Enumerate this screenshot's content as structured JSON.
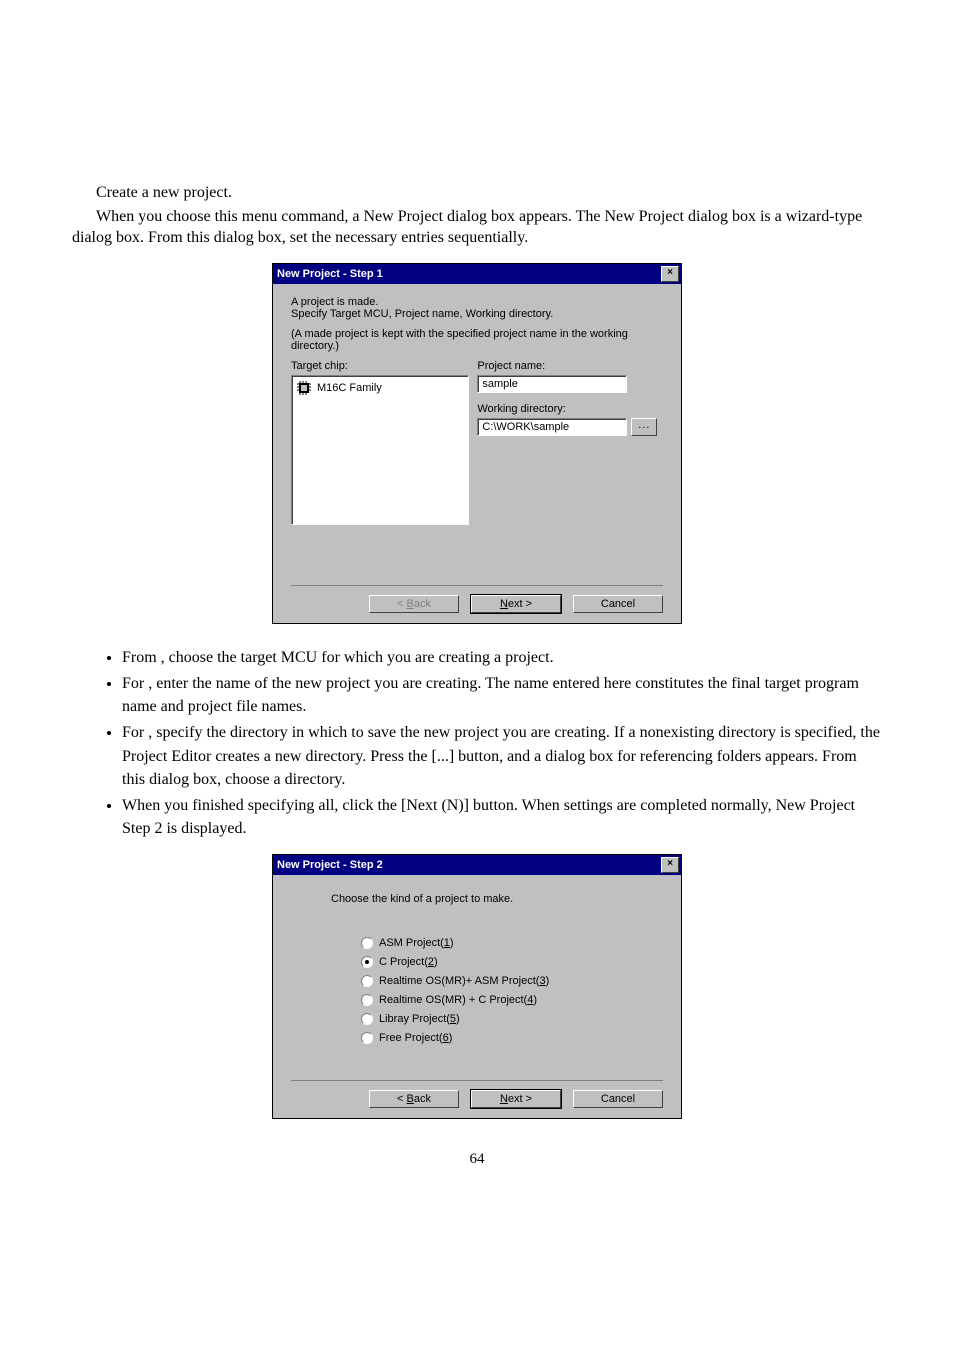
{
  "intro": {
    "p1": "Create a new project.",
    "p2": "When you choose this menu command, a New Project dialog box appears. The New Project dialog box is a wizard-type dialog box. From this dialog box, set the necessary entries sequentially."
  },
  "dialog1": {
    "title": "New Project - Step 1",
    "line1": "A project is made.",
    "line2": "Specify Target MCU, Project name, Working directory.",
    "line3": "(A made project is kept with the specified project name in the working directory.)",
    "target_chip_label": "Target chip:",
    "chip_item": "M16C Family",
    "project_name_label": "Project name:",
    "project_name_value": "sample",
    "working_dir_label": "Working directory:",
    "working_dir_value": "C:\\WORK\\sample",
    "browse": "...",
    "back": "< Back",
    "next": "Next >",
    "cancel": "Cancel"
  },
  "bullets1": {
    "b1_pre": "From ",
    "b1_post": ", choose the target MCU for which you are creating a project.",
    "b2_pre": "For ",
    "b2_post": ", enter the name of the new project you are creating. The name entered here constitutes the final target program name and project file names.",
    "b3_pre": "For ",
    "b3_post": ", specify the directory in which to save the new project you are creating. If a nonexisting directory is specified, the Project Editor creates a new directory. Press the [...] button, and a dialog box for referencing folders appears. From this dialog box, choose a directory.",
    "b4": "When you finished specifying all, click the [Next (N)] button. When settings are completed normally, New Project Step 2 is displayed."
  },
  "dialog2": {
    "title": "New Project - Step 2",
    "instruction": "Choose the kind of a project to make.",
    "options": [
      {
        "label_pre": "ASM Project(",
        "hot": "1",
        "label_post": ")"
      },
      {
        "label_pre": "C Project(",
        "hot": "2",
        "label_post": ")"
      },
      {
        "label_pre": "Realtime OS(MR)+ ASM Project(",
        "hot": "3",
        "label_post": ")"
      },
      {
        "label_pre": "Realtime OS(MR) + C Project(",
        "hot": "4",
        "label_post": ")"
      },
      {
        "label_pre": "Libray Project(",
        "hot": "5",
        "label_post": ")"
      },
      {
        "label_pre": "Free Project(",
        "hot": "6",
        "label_post": ")"
      }
    ],
    "selected_index": 1,
    "back": "< Back",
    "next": "Next >",
    "cancel": "Cancel"
  },
  "page_number": "64"
}
